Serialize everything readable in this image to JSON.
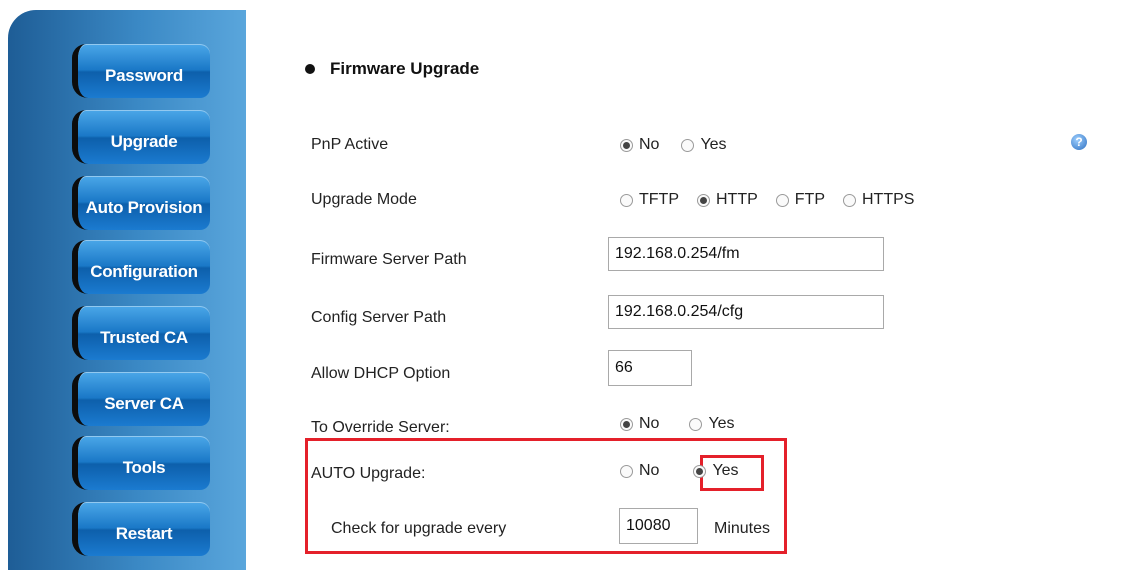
{
  "sidebar": {
    "items": [
      {
        "label": "Password"
      },
      {
        "label": "Upgrade"
      },
      {
        "label": "Auto Provision"
      },
      {
        "label": "Configuration"
      },
      {
        "label": "Trusted CA"
      },
      {
        "label": "Server CA"
      },
      {
        "label": "Tools"
      },
      {
        "label": "Restart"
      }
    ]
  },
  "section": {
    "title": "Firmware Upgrade"
  },
  "form": {
    "pnp": {
      "label": "PnP Active",
      "options": [
        "No",
        "Yes"
      ],
      "selected": "No"
    },
    "upgrade_mode": {
      "label": "Upgrade Mode",
      "options": [
        "TFTP",
        "HTTP",
        "FTP",
        "HTTPS"
      ],
      "selected": "HTTP"
    },
    "firmware_path": {
      "label": "Firmware Server Path",
      "value": "192.168.0.254/fm"
    },
    "config_path": {
      "label": "Config Server Path",
      "value": "192.168.0.254/cfg"
    },
    "dhcp_option": {
      "label": "Allow DHCP Option",
      "value": "66"
    },
    "override": {
      "label": "To Override Server:",
      "options": [
        "No",
        "Yes"
      ],
      "selected": "No"
    },
    "auto_upgrade": {
      "label": "AUTO Upgrade:",
      "options": [
        "No",
        "Yes"
      ],
      "selected": "Yes"
    },
    "check_interval": {
      "label": "Check for upgrade every",
      "value": "10080",
      "unit": "Minutes"
    }
  },
  "icons": {
    "help": "help-icon"
  },
  "colors": {
    "highlight": "#e4202a",
    "sidebar": "#2b76b6"
  }
}
